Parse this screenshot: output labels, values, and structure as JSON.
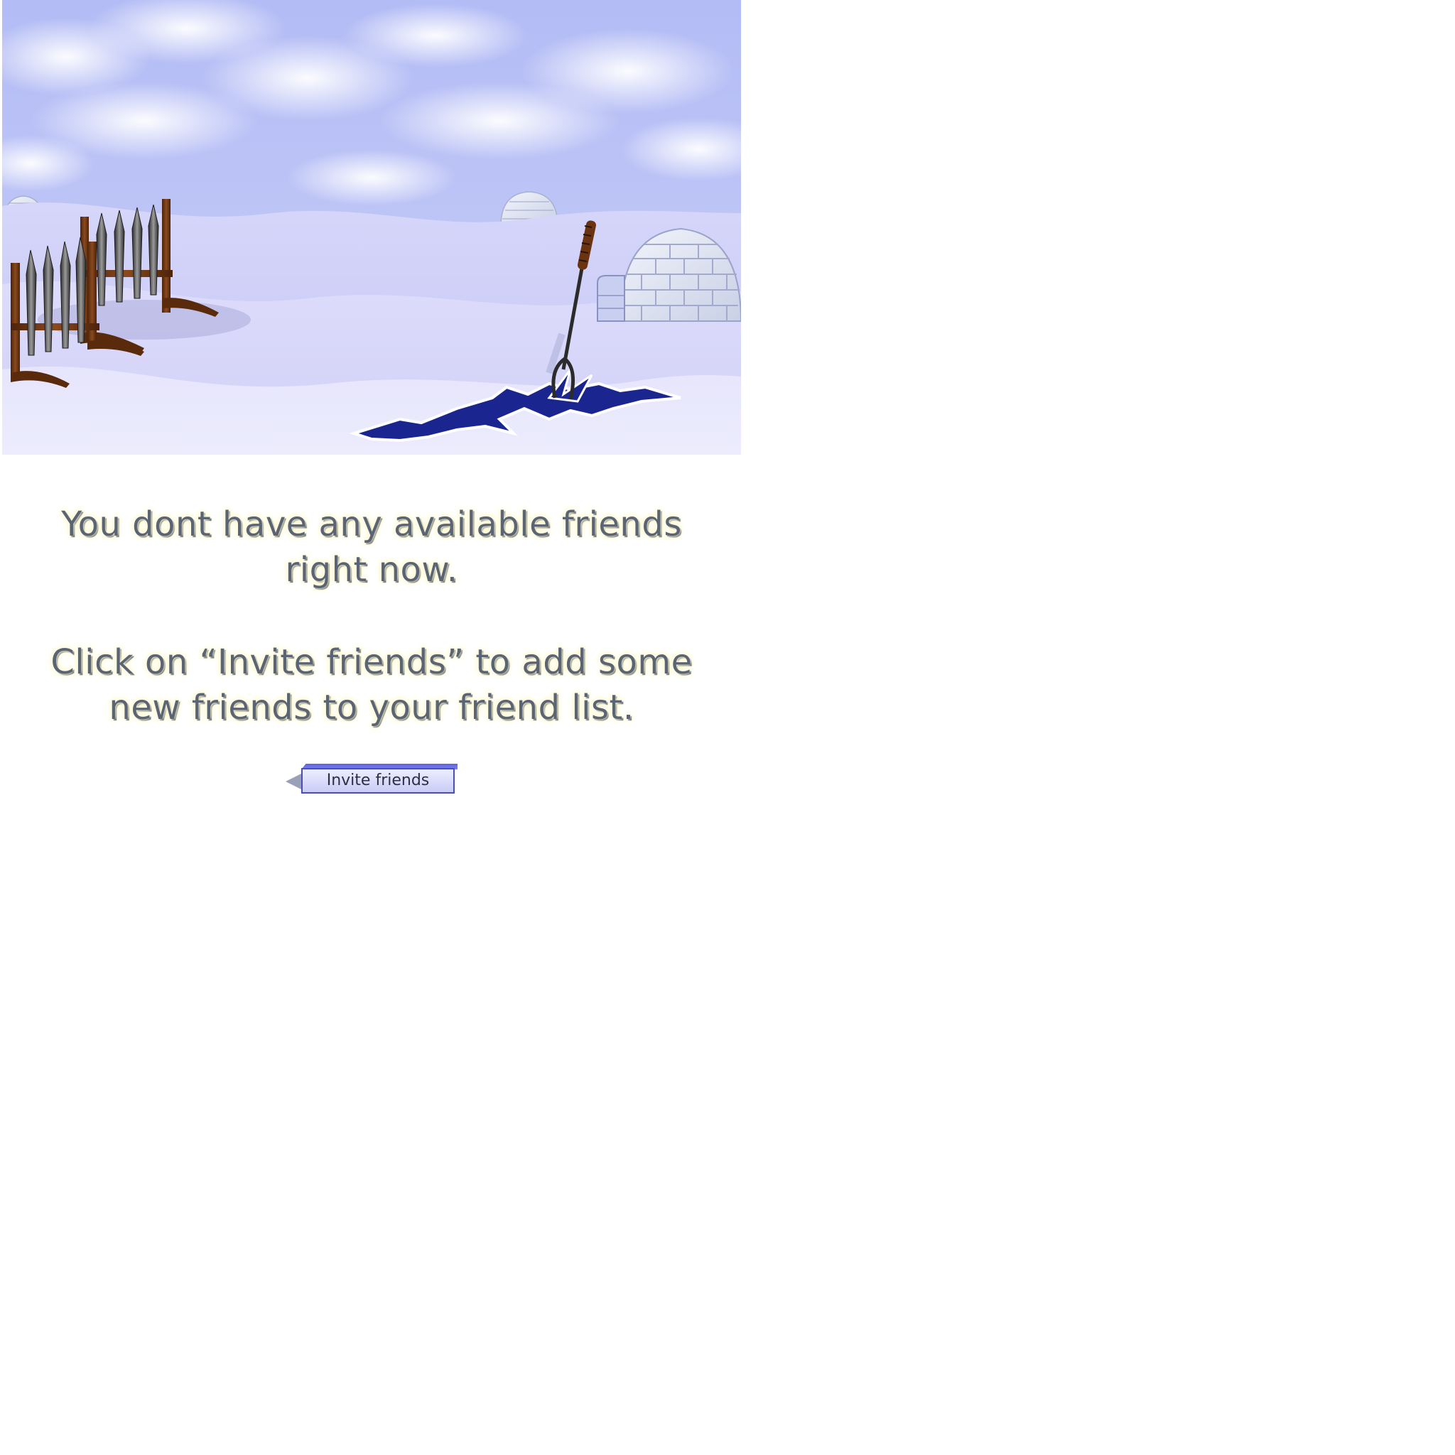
{
  "scene": {
    "name": "snowy-village-scene",
    "colors": {
      "sky": "#a8b2f5",
      "snow": "#dcdcfb",
      "crack": "#1b2590",
      "igloo": "#e7ecf6",
      "wood": "#6a3412"
    },
    "objects": [
      "weapon-rack-icon",
      "igloo-icon",
      "spear-icon",
      "ice-crack-icon"
    ]
  },
  "message": {
    "line1": "You dont have any available friends",
    "line2": "right now.",
    "line3": "Click on “Invite friends” to add some",
    "line4": "new friends to your friend list."
  },
  "invite_button": {
    "label": "Invite friends",
    "color": "#4a4fb8"
  }
}
